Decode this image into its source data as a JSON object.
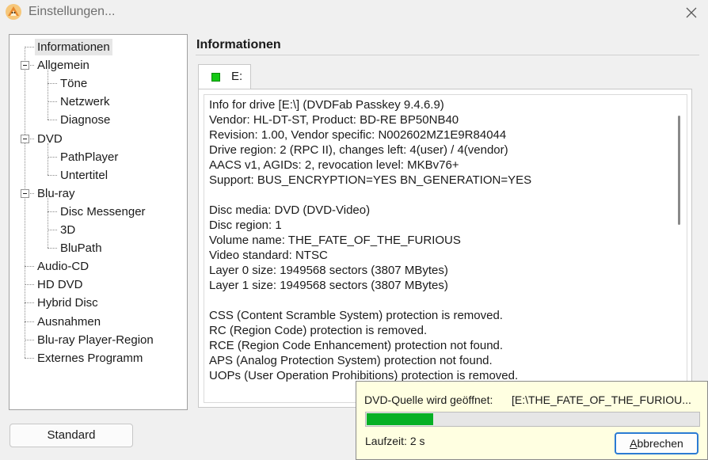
{
  "window": {
    "title": "Einstellungen...",
    "app_icon": "dvdfab-fox-icon",
    "close_icon": "close-icon"
  },
  "tree": {
    "items": [
      {
        "label": "Informationen",
        "level": 0,
        "expandable": false,
        "selected": true
      },
      {
        "label": "Allgemein",
        "level": 0,
        "expandable": true,
        "expanded": true
      },
      {
        "label": "Töne",
        "level": 1
      },
      {
        "label": "Netzwerk",
        "level": 1
      },
      {
        "label": "Diagnose",
        "level": 1
      },
      {
        "label": "DVD",
        "level": 0,
        "expandable": true,
        "expanded": true
      },
      {
        "label": "PathPlayer",
        "level": 1
      },
      {
        "label": "Untertitel",
        "level": 1
      },
      {
        "label": "Blu-ray",
        "level": 0,
        "expandable": true,
        "expanded": true
      },
      {
        "label": "Disc Messenger",
        "level": 1
      },
      {
        "label": "3D",
        "level": 1
      },
      {
        "label": "BluPath",
        "level": 1
      },
      {
        "label": "Audio-CD",
        "level": 0
      },
      {
        "label": "HD DVD",
        "level": 0
      },
      {
        "label": "Hybrid Disc",
        "level": 0
      },
      {
        "label": "Ausnahmen",
        "level": 0
      },
      {
        "label": "Blu-ray Player-Region",
        "level": 0
      },
      {
        "label": "Externes Programm",
        "level": 0
      }
    ]
  },
  "main": {
    "section_title": "Informationen",
    "tab": {
      "label": "E:",
      "status_color": "#14c814"
    },
    "info_lines": [
      "Info for drive [E:\\] (DVDFab Passkey 9.4.6.9)",
      "Vendor: HL-DT-ST, Product: BD-RE BP50NB40",
      "Revision: 1.00, Vendor specific: N002602MZ1E9R84044",
      "Drive region: 2 (RPC II), changes left: 4(user) / 4(vendor)",
      "AACS v1, AGIDs: 2, revocation level: MKBv76+",
      "Support: BUS_ENCRYPTION=YES BN_GENERATION=YES",
      "",
      "Disc media: DVD (DVD-Video)",
      "Disc region: 1",
      "Volume name: THE_FATE_OF_THE_FURIOUS",
      "Video standard: NTSC",
      "Layer 0 size: 1949568 sectors (3807 MBytes)",
      "Layer 1 size: 1949568 sectors (3807 MBytes)",
      "",
      "CSS (Content Scramble System) protection is removed.",
      "RC (Region Code) protection is removed.",
      "RCE (Region Code Enhancement) protection not found.",
      "APS (Analog Protection System) protection not found.",
      "UOPs (User Operation Prohibitions) protection is removed."
    ]
  },
  "footer": {
    "standard_button": "Standard"
  },
  "progress_popup": {
    "status": "DVD-Quelle wird geöffnet:",
    "path": "[E:\\THE_FATE_OF_THE_FURIOU...",
    "progress_fraction": 0.2,
    "progress_color": "#06b025",
    "runtime": "Laufzeit: 2 s",
    "cancel_label_mnemonic": "A",
    "cancel_label_rest": "bbrechen"
  }
}
